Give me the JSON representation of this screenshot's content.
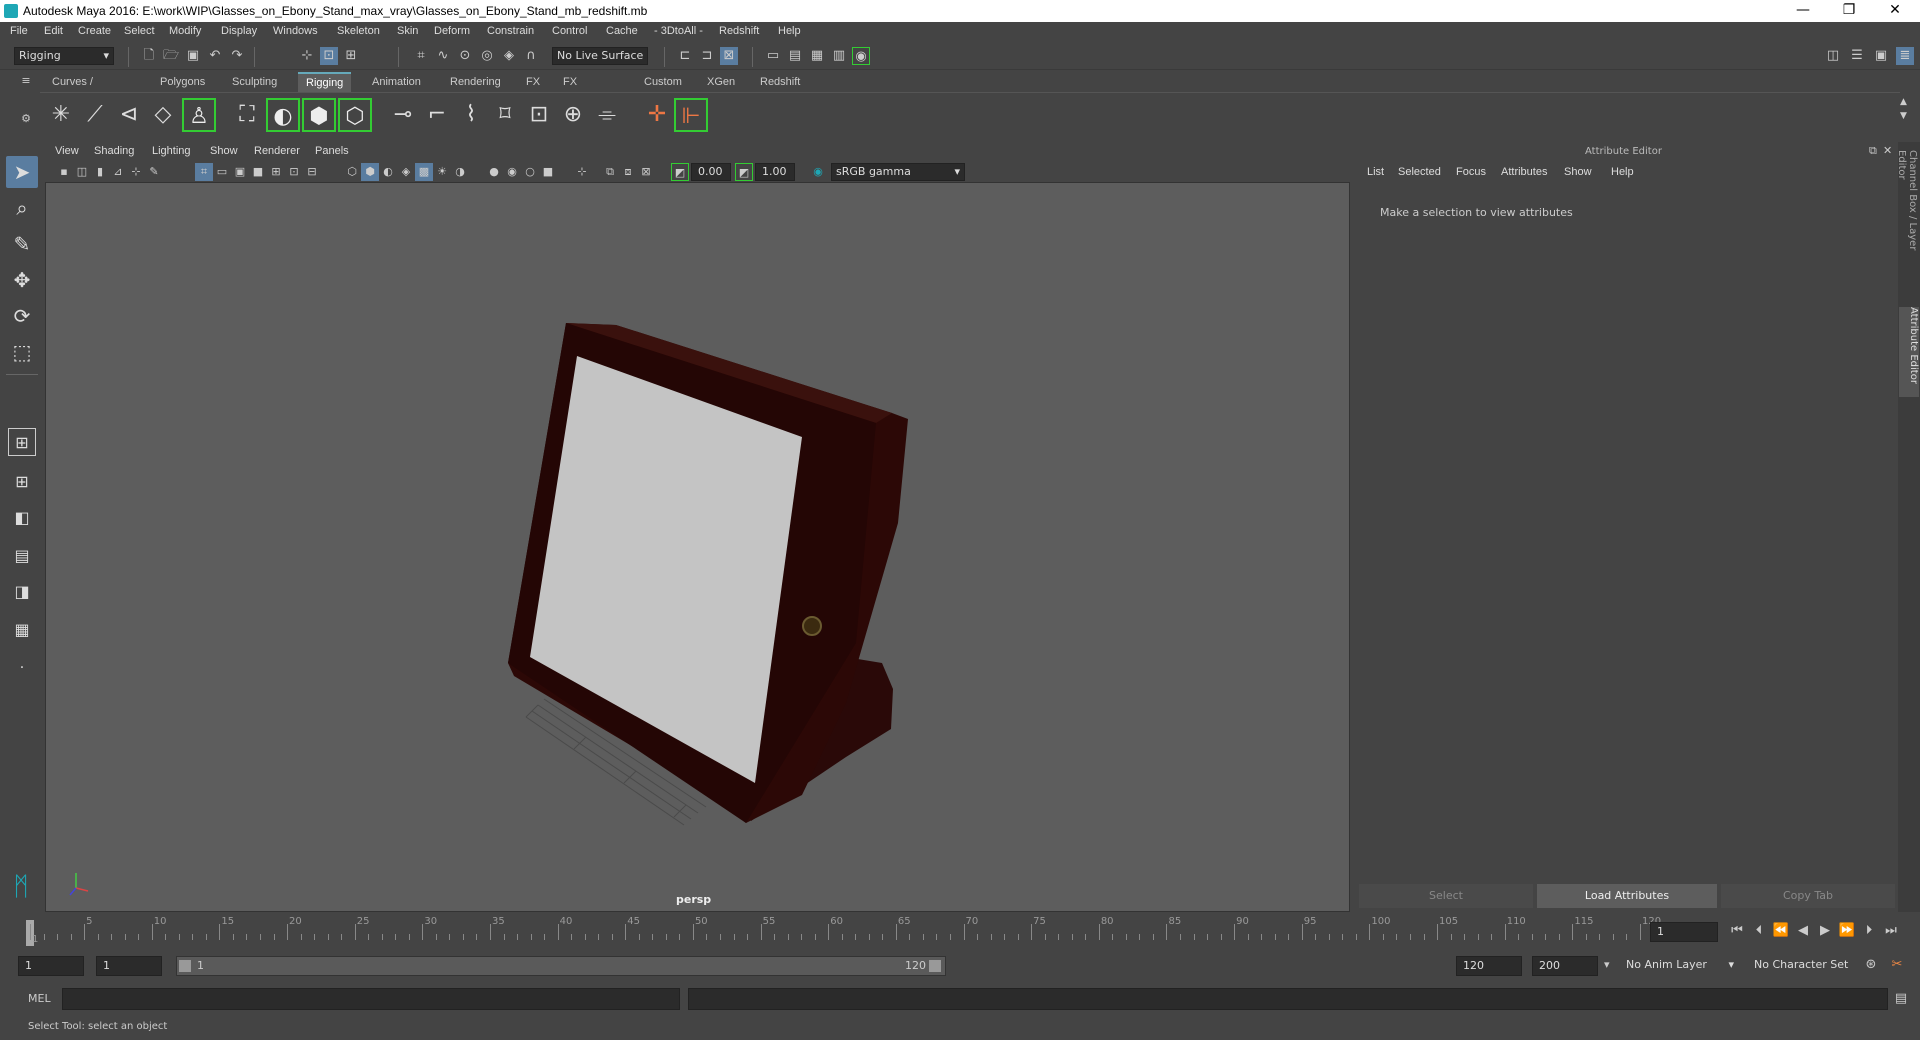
{
  "window": {
    "title": "Autodesk Maya 2016: E:\\work\\WIP\\Glasses_on_Ebony_Stand_max_vray\\Glasses_on_Ebony_Stand_mb_redshift.mb",
    "minimize": "—",
    "maximize": "❐",
    "close": "✕"
  },
  "menubar": [
    "File",
    "Edit",
    "Create",
    "Select",
    "Modify",
    "Display",
    "Windows",
    "Skeleton",
    "Skin",
    "Deform",
    "Constrain",
    "Control",
    "Cache",
    "- 3DtoAll -",
    "Redshift",
    "Help"
  ],
  "toolbar": {
    "menu_set": "Rigging",
    "live_surface": "No Live Surface"
  },
  "shelf_tabs": [
    "Curves / Surfaces",
    "Polygons",
    "Sculpting",
    "Rigging",
    "Animation",
    "Rendering",
    "FX",
    "FX Caching",
    "Custom",
    "XGen",
    "Redshift"
  ],
  "active_shelf_tab": "Rigging",
  "viewport": {
    "menus": [
      "View",
      "Shading",
      "Lighting",
      "Show",
      "Renderer",
      "Panels"
    ],
    "exposure": "0.00",
    "gamma": "1.00",
    "color_space": "sRGB gamma",
    "camera_label": "persp"
  },
  "attribute_editor": {
    "header": "Attribute Editor",
    "menus": [
      "List",
      "Selected",
      "Focus",
      "Attributes",
      "Show",
      "Help"
    ],
    "message": "Make a selection to view attributes",
    "buttons": {
      "select": "Select",
      "load": "Load Attributes",
      "copy": "Copy Tab"
    }
  },
  "side_tabs": {
    "channel_box": "Channel Box / Layer Editor",
    "attribute_editor": "Attribute Editor"
  },
  "timeline": {
    "labels": [
      "1",
      "5",
      "10",
      "15",
      "20",
      "25",
      "30",
      "35",
      "40",
      "45",
      "50",
      "55",
      "60",
      "65",
      "70",
      "75",
      "80",
      "85",
      "90",
      "95",
      "100",
      "105",
      "110",
      "115",
      "120"
    ],
    "current_frame": "1"
  },
  "range": {
    "start": "1",
    "anim_start": "1",
    "slider_start": "1",
    "slider_end": "120",
    "anim_end": "120",
    "end": "200",
    "anim_layer": "No Anim Layer",
    "character_set": "No Character Set"
  },
  "cmdline": {
    "label": "MEL"
  },
  "helpline": {
    "text": "Select Tool: select an object"
  }
}
